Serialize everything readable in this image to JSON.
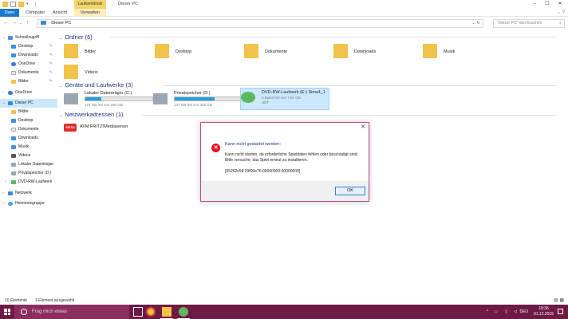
{
  "titlebar": {
    "context_tab": "Laufwerktools",
    "title": "Dieser PC"
  },
  "ribbon": {
    "tabs": [
      "Datei",
      "Computer",
      "Ansicht",
      "Verwalten"
    ]
  },
  "navigation": {
    "address": "Dieser PC",
    "search_placeholder": "\"Dieser PC\" durchsuchen"
  },
  "sidebar": {
    "quick_access": "Schnellzugriff",
    "pinned": [
      "Desktop",
      "Downloads",
      "OneDrive",
      "Dokumente",
      "Bilder"
    ],
    "onedrive": "OneDrive",
    "this_pc": "Dieser PC",
    "pc_items": [
      "Bilder",
      "Desktop",
      "Dokumente",
      "Downloads",
      "Musik",
      "Videos",
      "Lokaler Datenträger",
      "Privatspeicher (D:)",
      "DVD-RW-Laufwerk"
    ],
    "network": "Netzwerk",
    "homegroup": "Heimnetzgruppe"
  },
  "content": {
    "folders_header": "Ordner (6)",
    "folders": [
      "Bilder",
      "Desktop",
      "Dokumente",
      "Downloads",
      "Musik",
      "Videos"
    ],
    "drives_header": "Geräte und Laufwerke (3)",
    "drives": [
      {
        "name": "Lokaler Datenträger (C:)",
        "free": "174 GB frei von 230 GB",
        "used_fraction": 0.24
      },
      {
        "name": "Privatspeicher (D:)",
        "free": "137 GB frei von 345 GB",
        "used_fraction": 0.6
      },
      {
        "name": "DVD-RW-Laufwerk (E:) Sims4_1",
        "free": "0 Bytes frei von 7,81 GB",
        "fs": "UDF"
      }
    ],
    "net_header": "Netzwerkadressen (1)",
    "net_items": [
      {
        "name": "AVM FRITZ!Mediaserver",
        "icon_text": "FRITZ!"
      }
    ]
  },
  "dialog": {
    "heading": "Kann nicht gestartet werden:",
    "message": "Kann nicht starten, da erforderliche Spieldaten fehlen oder beschädigt sind. Bitte versuche, das Spiel erneut zu installieren.",
    "code": "[05262c58:29f00e76:00000000:00000000]",
    "ok_label": "OK"
  },
  "statusbar": {
    "count": "10 Elemente",
    "selected": "1 Element ausgewählt"
  },
  "taskbar": {
    "search_placeholder": "Frag mich etwas",
    "language": "DEU",
    "time": "18:36",
    "date": "01.12.2015"
  },
  "colors": {
    "accent": "#1979ca",
    "taskbar": "#6e1a45",
    "dialog_border": "#c34c84",
    "drive_fill": "#26a0da"
  }
}
